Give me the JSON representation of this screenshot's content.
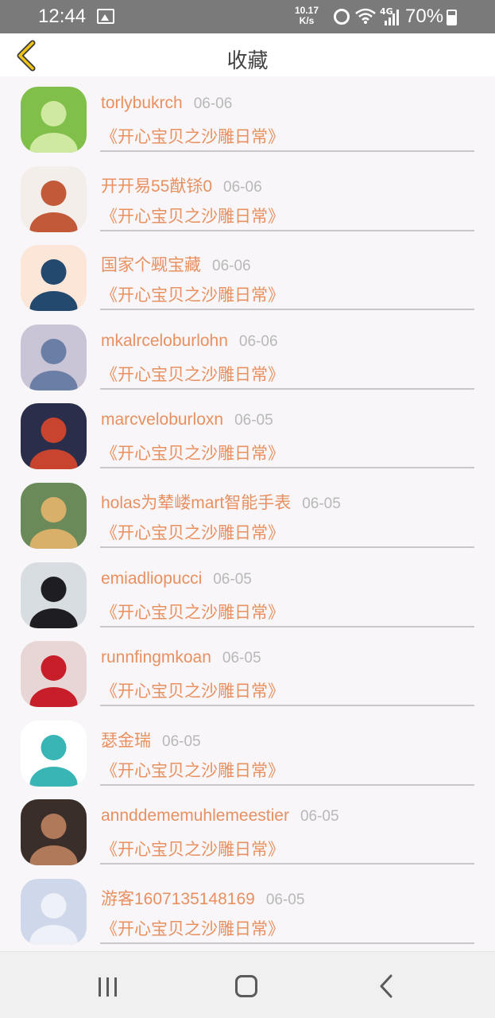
{
  "status_bar": {
    "time": "12:44",
    "speed_value": "10.17",
    "speed_unit": "K/s",
    "network": "4G",
    "battery": "70%",
    "icons": [
      "image-icon",
      "alarm-icon",
      "wifi-icon",
      "signal-icon",
      "battery-icon"
    ]
  },
  "header": {
    "title": "收藏"
  },
  "favorites": [
    {
      "user": "torlybukrch",
      "date": "06-06",
      "work": "《开心宝贝之沙雕日常》",
      "avatar_bg": "#7fbf4a",
      "avatar_fg": "#cfe9a0"
    },
    {
      "user": "开开易55猷铩0",
      "date": "06-06",
      "work": "《开心宝贝之沙雕日常》",
      "avatar_bg": "#f4eeea",
      "avatar_fg": "#c25a3a"
    },
    {
      "user": "国家个觋宝藏",
      "date": "06-06",
      "work": "《开心宝贝之沙雕日常》",
      "avatar_bg": "#fbe6d8",
      "avatar_fg": "#234a6e"
    },
    {
      "user": "mkalrceloburlohn",
      "date": "06-06",
      "work": "《开心宝贝之沙雕日常》",
      "avatar_bg": "#c9c4d6",
      "avatar_fg": "#6b7fa6"
    },
    {
      "user": "marcveloburloxn",
      "date": "06-05",
      "work": "《开心宝贝之沙雕日常》",
      "avatar_bg": "#2a2e4a",
      "avatar_fg": "#c8442f"
    },
    {
      "user": "holas为辇嵝mart智能手表",
      "date": "06-05",
      "work": "《开心宝贝之沙雕日常》",
      "avatar_bg": "#6a8a5a",
      "avatar_fg": "#d8b06a"
    },
    {
      "user": "emiadliopucci",
      "date": "06-05",
      "work": "《开心宝贝之沙雕日常》",
      "avatar_bg": "#d8dde2",
      "avatar_fg": "#1e1e22"
    },
    {
      "user": "runnfingmkoan",
      "date": "06-05",
      "work": "《开心宝贝之沙雕日常》",
      "avatar_bg": "#e8d6d6",
      "avatar_fg": "#c81e2a"
    },
    {
      "user": "瑟金瑞",
      "date": "06-05",
      "work": "《开心宝贝之沙雕日常》",
      "avatar_bg": "#ffffff",
      "avatar_fg": "#3ab5b5"
    },
    {
      "user": "annddememuhlemeestier",
      "date": "06-05",
      "work": "《开心宝贝之沙雕日常》",
      "avatar_bg": "#3a2e2a",
      "avatar_fg": "#b07a5a"
    },
    {
      "user": "游客1607135148169",
      "date": "06-05",
      "work": "《开心宝贝之沙雕日常》",
      "avatar_bg": "#cfd8ea",
      "avatar_fg": "#eef1f7"
    }
  ],
  "colors": {
    "accent": "#e89060",
    "date": "#b8b8b8",
    "back_chevron": "#f0c419"
  },
  "nav": {
    "icons": [
      "recents-icon",
      "home-icon",
      "back-icon"
    ]
  }
}
